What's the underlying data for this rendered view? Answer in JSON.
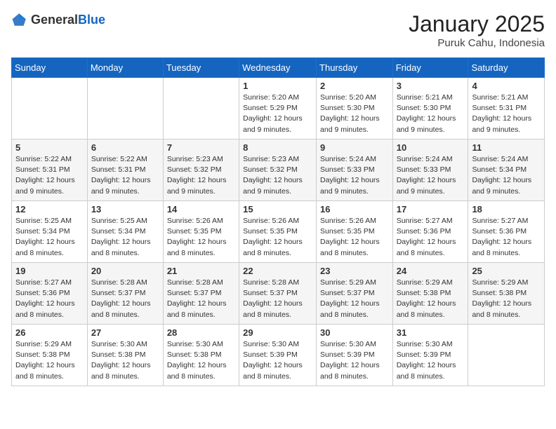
{
  "header": {
    "logo_general": "General",
    "logo_blue": "Blue",
    "month": "January 2025",
    "location": "Puruk Cahu, Indonesia"
  },
  "weekdays": [
    "Sunday",
    "Monday",
    "Tuesday",
    "Wednesday",
    "Thursday",
    "Friday",
    "Saturday"
  ],
  "weeks": [
    [
      {
        "day": "",
        "sunrise": "",
        "sunset": "",
        "daylight": ""
      },
      {
        "day": "",
        "sunrise": "",
        "sunset": "",
        "daylight": ""
      },
      {
        "day": "",
        "sunrise": "",
        "sunset": "",
        "daylight": ""
      },
      {
        "day": "1",
        "sunrise": "Sunrise: 5:20 AM",
        "sunset": "Sunset: 5:29 PM",
        "daylight": "Daylight: 12 hours and 9 minutes."
      },
      {
        "day": "2",
        "sunrise": "Sunrise: 5:20 AM",
        "sunset": "Sunset: 5:30 PM",
        "daylight": "Daylight: 12 hours and 9 minutes."
      },
      {
        "day": "3",
        "sunrise": "Sunrise: 5:21 AM",
        "sunset": "Sunset: 5:30 PM",
        "daylight": "Daylight: 12 hours and 9 minutes."
      },
      {
        "day": "4",
        "sunrise": "Sunrise: 5:21 AM",
        "sunset": "Sunset: 5:31 PM",
        "daylight": "Daylight: 12 hours and 9 minutes."
      }
    ],
    [
      {
        "day": "5",
        "sunrise": "Sunrise: 5:22 AM",
        "sunset": "Sunset: 5:31 PM",
        "daylight": "Daylight: 12 hours and 9 minutes."
      },
      {
        "day": "6",
        "sunrise": "Sunrise: 5:22 AM",
        "sunset": "Sunset: 5:31 PM",
        "daylight": "Daylight: 12 hours and 9 minutes."
      },
      {
        "day": "7",
        "sunrise": "Sunrise: 5:23 AM",
        "sunset": "Sunset: 5:32 PM",
        "daylight": "Daylight: 12 hours and 9 minutes."
      },
      {
        "day": "8",
        "sunrise": "Sunrise: 5:23 AM",
        "sunset": "Sunset: 5:32 PM",
        "daylight": "Daylight: 12 hours and 9 minutes."
      },
      {
        "day": "9",
        "sunrise": "Sunrise: 5:24 AM",
        "sunset": "Sunset: 5:33 PM",
        "daylight": "Daylight: 12 hours and 9 minutes."
      },
      {
        "day": "10",
        "sunrise": "Sunrise: 5:24 AM",
        "sunset": "Sunset: 5:33 PM",
        "daylight": "Daylight: 12 hours and 9 minutes."
      },
      {
        "day": "11",
        "sunrise": "Sunrise: 5:24 AM",
        "sunset": "Sunset: 5:34 PM",
        "daylight": "Daylight: 12 hours and 9 minutes."
      }
    ],
    [
      {
        "day": "12",
        "sunrise": "Sunrise: 5:25 AM",
        "sunset": "Sunset: 5:34 PM",
        "daylight": "Daylight: 12 hours and 8 minutes."
      },
      {
        "day": "13",
        "sunrise": "Sunrise: 5:25 AM",
        "sunset": "Sunset: 5:34 PM",
        "daylight": "Daylight: 12 hours and 8 minutes."
      },
      {
        "day": "14",
        "sunrise": "Sunrise: 5:26 AM",
        "sunset": "Sunset: 5:35 PM",
        "daylight": "Daylight: 12 hours and 8 minutes."
      },
      {
        "day": "15",
        "sunrise": "Sunrise: 5:26 AM",
        "sunset": "Sunset: 5:35 PM",
        "daylight": "Daylight: 12 hours and 8 minutes."
      },
      {
        "day": "16",
        "sunrise": "Sunrise: 5:26 AM",
        "sunset": "Sunset: 5:35 PM",
        "daylight": "Daylight: 12 hours and 8 minutes."
      },
      {
        "day": "17",
        "sunrise": "Sunrise: 5:27 AM",
        "sunset": "Sunset: 5:36 PM",
        "daylight": "Daylight: 12 hours and 8 minutes."
      },
      {
        "day": "18",
        "sunrise": "Sunrise: 5:27 AM",
        "sunset": "Sunset: 5:36 PM",
        "daylight": "Daylight: 12 hours and 8 minutes."
      }
    ],
    [
      {
        "day": "19",
        "sunrise": "Sunrise: 5:27 AM",
        "sunset": "Sunset: 5:36 PM",
        "daylight": "Daylight: 12 hours and 8 minutes."
      },
      {
        "day": "20",
        "sunrise": "Sunrise: 5:28 AM",
        "sunset": "Sunset: 5:37 PM",
        "daylight": "Daylight: 12 hours and 8 minutes."
      },
      {
        "day": "21",
        "sunrise": "Sunrise: 5:28 AM",
        "sunset": "Sunset: 5:37 PM",
        "daylight": "Daylight: 12 hours and 8 minutes."
      },
      {
        "day": "22",
        "sunrise": "Sunrise: 5:28 AM",
        "sunset": "Sunset: 5:37 PM",
        "daylight": "Daylight: 12 hours and 8 minutes."
      },
      {
        "day": "23",
        "sunrise": "Sunrise: 5:29 AM",
        "sunset": "Sunset: 5:37 PM",
        "daylight": "Daylight: 12 hours and 8 minutes."
      },
      {
        "day": "24",
        "sunrise": "Sunrise: 5:29 AM",
        "sunset": "Sunset: 5:38 PM",
        "daylight": "Daylight: 12 hours and 8 minutes."
      },
      {
        "day": "25",
        "sunrise": "Sunrise: 5:29 AM",
        "sunset": "Sunset: 5:38 PM",
        "daylight": "Daylight: 12 hours and 8 minutes."
      }
    ],
    [
      {
        "day": "26",
        "sunrise": "Sunrise: 5:29 AM",
        "sunset": "Sunset: 5:38 PM",
        "daylight": "Daylight: 12 hours and 8 minutes."
      },
      {
        "day": "27",
        "sunrise": "Sunrise: 5:30 AM",
        "sunset": "Sunset: 5:38 PM",
        "daylight": "Daylight: 12 hours and 8 minutes."
      },
      {
        "day": "28",
        "sunrise": "Sunrise: 5:30 AM",
        "sunset": "Sunset: 5:38 PM",
        "daylight": "Daylight: 12 hours and 8 minutes."
      },
      {
        "day": "29",
        "sunrise": "Sunrise: 5:30 AM",
        "sunset": "Sunset: 5:39 PM",
        "daylight": "Daylight: 12 hours and 8 minutes."
      },
      {
        "day": "30",
        "sunrise": "Sunrise: 5:30 AM",
        "sunset": "Sunset: 5:39 PM",
        "daylight": "Daylight: 12 hours and 8 minutes."
      },
      {
        "day": "31",
        "sunrise": "Sunrise: 5:30 AM",
        "sunset": "Sunset: 5:39 PM",
        "daylight": "Daylight: 12 hours and 8 minutes."
      },
      {
        "day": "",
        "sunrise": "",
        "sunset": "",
        "daylight": ""
      }
    ]
  ]
}
